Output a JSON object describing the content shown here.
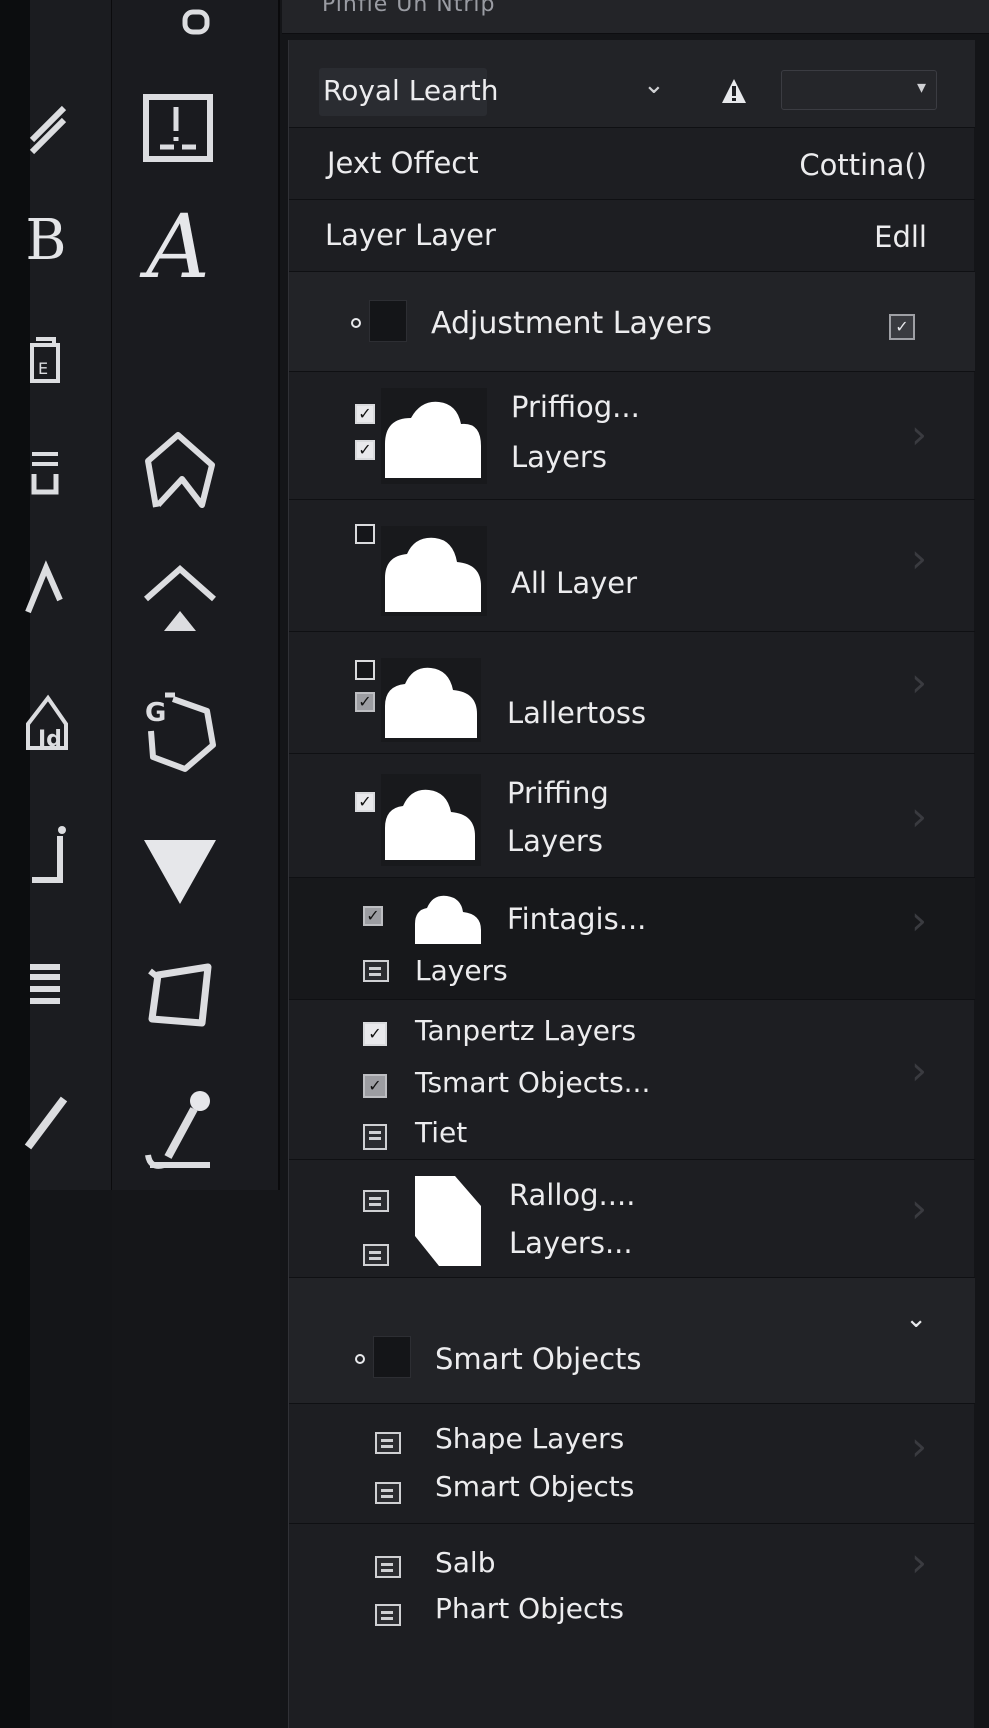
{
  "window": {
    "title": "Pinfle Un Ntrip"
  },
  "toolbar_left": {
    "edge_glyphs": [
      "/",
      "B",
      "E",
      "U",
      "A",
      "Id",
      "J",
      "≡",
      "/"
    ],
    "tools": [
      {
        "name": "marquee-tool-icon"
      },
      {
        "name": "crop-frame-icon"
      },
      {
        "name": "type-tool-icon",
        "glyph": "A"
      },
      {
        "name": "pen-tool-icon"
      },
      {
        "name": "arrow-up-tool-icon"
      },
      {
        "name": "rotate-tool-icon"
      },
      {
        "name": "triangle-tool-icon"
      },
      {
        "name": "transform-tool-icon"
      },
      {
        "name": "brush-tool-icon"
      }
    ]
  },
  "panel": {
    "header": {
      "selected": "Royal Learth",
      "dropdown_value": ""
    },
    "rows": [
      {
        "left": "Jext Offect",
        "right": "Cottina()"
      },
      {
        "left": "Layer Layer",
        "right": "Edll"
      }
    ],
    "section1": {
      "title": "Adjustment Layers",
      "checked": true
    },
    "layers": [
      {
        "lines": [
          "Priffiog...",
          "Layers"
        ]
      },
      {
        "lines": [
          "All Layer"
        ]
      },
      {
        "lines": [
          "Lallertoss"
        ]
      },
      {
        "lines": [
          "Priffing",
          "Layers"
        ]
      },
      {
        "lines": [
          "Fintagis...",
          "Layers"
        ]
      },
      {
        "lines": [
          "Tanpertz Layers",
          "Tsmart Objects...",
          "Tiet"
        ]
      },
      {
        "lines": [
          "Rallog....",
          "Layers..."
        ]
      }
    ],
    "section2": {
      "title": "Smart Objects"
    },
    "smart_items": [
      {
        "lines": [
          "Shape Layers",
          "Smart Objects"
        ]
      },
      {
        "lines": [
          "Salb",
          "Phart Objects"
        ]
      }
    ]
  }
}
